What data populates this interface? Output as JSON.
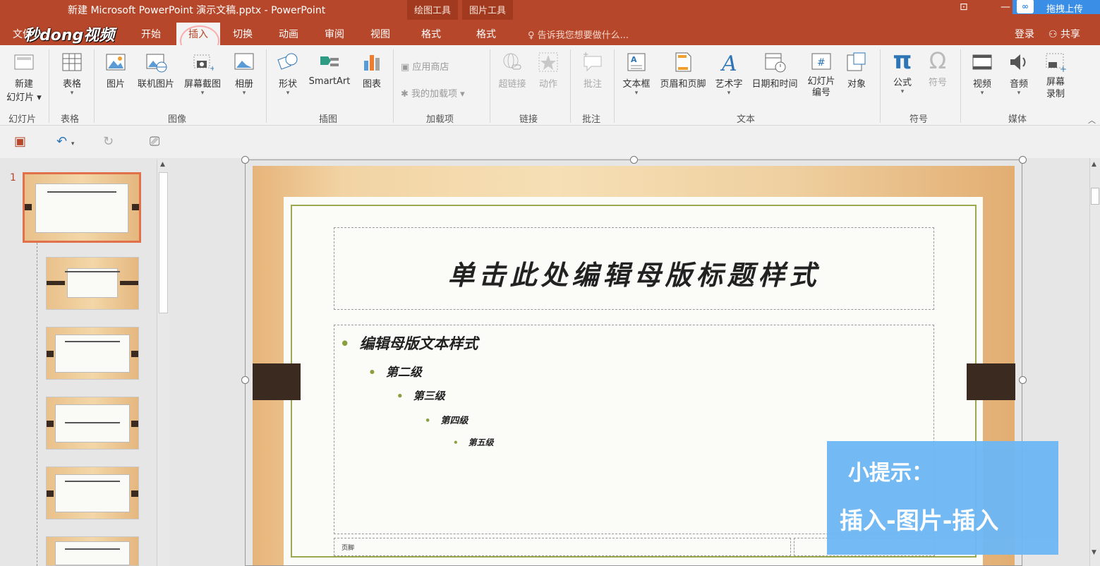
{
  "window": {
    "title": "新建 Microsoft PowerPoint 演示文稿.pptx - PowerPoint",
    "context_groups": [
      "绘图工具",
      "图片工具"
    ],
    "upload_label": "拖拽上传",
    "upload_icon": "cloud-icon"
  },
  "tabs": {
    "file": "文件",
    "logo": "秒dong视频",
    "items": [
      "开始",
      "插入",
      "切换",
      "动画",
      "审阅",
      "视图"
    ],
    "active": "插入",
    "format_draw": "格式",
    "format_pic": "格式",
    "tell_me": "告诉我您想要做什么...",
    "login": "登录",
    "share": "共享"
  },
  "ribbon": {
    "groups": [
      "幻灯片",
      "表格",
      "图像",
      "插图",
      "加载项",
      "链接",
      "批注",
      "文本",
      "符号",
      "媒体"
    ],
    "new_slide": [
      "新建",
      "幻灯片"
    ],
    "table": "表格",
    "image_items": [
      "图片",
      "联机图片",
      "屏幕截图",
      "相册"
    ],
    "illustration_items": [
      "形状",
      "SmartArt",
      "图表"
    ],
    "addin_items": [
      "应用商店",
      "我的加载项"
    ],
    "link_items": [
      "超链接",
      "动作"
    ],
    "comment": "批注",
    "text_items": [
      "文本框",
      "页眉和页脚",
      "艺术字",
      "日期和时间",
      "幻灯片编号",
      "对象"
    ],
    "symbol_items": [
      "公式",
      "符号"
    ],
    "symbol_glyphs": [
      "π",
      "Ω"
    ],
    "media_items": [
      "视频",
      "音频",
      "屏幕录制"
    ]
  },
  "qat": {
    "icons": [
      "save-icon",
      "undo-icon",
      "redo-icon",
      "presentation-icon"
    ]
  },
  "thumbnails": {
    "first_number": "1",
    "count_visible": 6
  },
  "slide": {
    "title": "单击此处编辑母版标题样式",
    "levels": [
      "编辑母版文本样式",
      "第二级",
      "第三级",
      "第四级",
      "第五级"
    ],
    "footer": "页脚"
  },
  "tip": {
    "title": "小提示：",
    "text": "插入-图片-插入"
  },
  "colors": {
    "accent": "#b7472a",
    "tip_bg": "#6eb7f4",
    "bullet": "#8aa040"
  }
}
